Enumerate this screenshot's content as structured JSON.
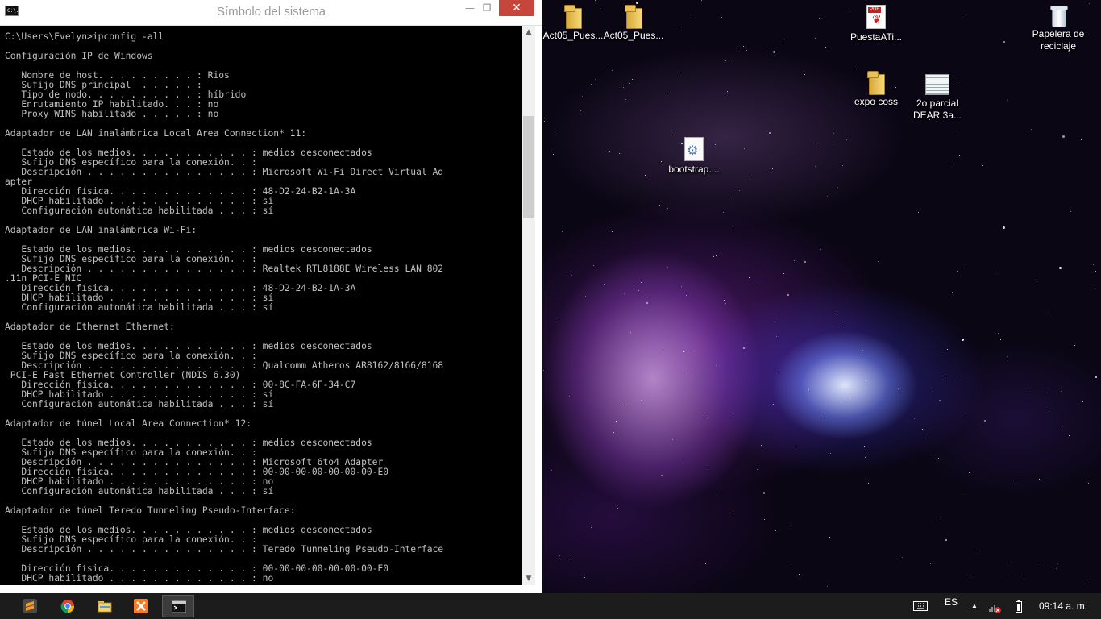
{
  "window": {
    "title": "Símbolo del sistema",
    "icon_label": "C:\\.",
    "minimize_glyph": "—",
    "maximize_glyph": "❐",
    "close_glyph": "✕"
  },
  "console_lines": [
    "C:\\Users\\Evelyn>ipconfig -all",
    "",
    "Configuración IP de Windows",
    "",
    "   Nombre de host. . . . . . . . . : Rios",
    "   Sufijo DNS principal  . . . . . :",
    "   Tipo de nodo. . . . . . . . . . : híbrido",
    "   Enrutamiento IP habilitado. . . : no",
    "   Proxy WINS habilitado . . . . . : no",
    "",
    "Adaptador de LAN inalámbrica Local Area Connection* 11:",
    "",
    "   Estado de los medios. . . . . . . . . . . : medios desconectados",
    "   Sufijo DNS específico para la conexión. . :",
    "   Descripción . . . . . . . . . . . . . . . : Microsoft Wi-Fi Direct Virtual Ad",
    "apter",
    "   Dirección física. . . . . . . . . . . . . : 48-D2-24-B2-1A-3A",
    "   DHCP habilitado . . . . . . . . . . . . . : sí",
    "   Configuración automática habilitada . . . : sí",
    "",
    "Adaptador de LAN inalámbrica Wi-Fi:",
    "",
    "   Estado de los medios. . . . . . . . . . . : medios desconectados",
    "   Sufijo DNS específico para la conexión. . :",
    "   Descripción . . . . . . . . . . . . . . . : Realtek RTL8188E Wireless LAN 802",
    ".11n PCI-E NIC",
    "   Dirección física. . . . . . . . . . . . . : 48-D2-24-B2-1A-3A",
    "   DHCP habilitado . . . . . . . . . . . . . : sí",
    "   Configuración automática habilitada . . . : sí",
    "",
    "Adaptador de Ethernet Ethernet:",
    "",
    "   Estado de los medios. . . . . . . . . . . : medios desconectados",
    "   Sufijo DNS específico para la conexión. . :",
    "   Descripción . . . . . . . . . . . . . . . : Qualcomm Atheros AR8162/8166/8168",
    " PCI-E Fast Ethernet Controller (NDIS 6.30)",
    "   Dirección física. . . . . . . . . . . . . : 00-8C-FA-6F-34-C7",
    "   DHCP habilitado . . . . . . . . . . . . . : sí",
    "   Configuración automática habilitada . . . : sí",
    "",
    "Adaptador de túnel Local Area Connection* 12:",
    "",
    "   Estado de los medios. . . . . . . . . . . : medios desconectados",
    "   Sufijo DNS específico para la conexión. . :",
    "   Descripción . . . . . . . . . . . . . . . : Microsoft 6to4 Adapter",
    "   Dirección física. . . . . . . . . . . . . : 00-00-00-00-00-00-00-E0",
    "   DHCP habilitado . . . . . . . . . . . . . : no",
    "   Configuración automática habilitada . . . : sí",
    "",
    "Adaptador de túnel Teredo Tunneling Pseudo-Interface:",
    "",
    "   Estado de los medios. . . . . . . . . . . : medios desconectados",
    "   Sufijo DNS específico para la conexión. . :",
    "   Descripción . . . . . . . . . . . . . . . : Teredo Tunneling Pseudo-Interface",
    "",
    "   Dirección física. . . . . . . . . . . . . : 00-00-00-00-00-00-00-E0",
    "   DHCP habilitado . . . . . . . . . . . . . : no"
  ],
  "scrollbar": {
    "up_glyph": "▲",
    "down_glyph": "▼"
  },
  "desktop_icons": [
    {
      "name": "folder-act05-1",
      "label": "Act05_Pues...",
      "type": "folder"
    },
    {
      "name": "folder-act05-2",
      "label": "Act05_Pues...",
      "type": "folder"
    },
    {
      "name": "pdf-puesta",
      "label": "PuestaATi...",
      "type": "pdf"
    },
    {
      "name": "recycle-bin",
      "label": "Papelera de reciclaje",
      "type": "bin"
    },
    {
      "name": "folder-expo-coss",
      "label": "expo coss",
      "type": "folder"
    },
    {
      "name": "doc-2o-parcial",
      "label": "2o parcial DEAR 3a...",
      "type": "doc"
    },
    {
      "name": "file-bootstrap",
      "label": "bootstrap....",
      "type": "cfg"
    }
  ],
  "pdf_tag": "PDF",
  "taskbar": {
    "apps": [
      {
        "name": "sublime-text",
        "icon": "sublime-icon"
      },
      {
        "name": "chrome",
        "icon": "chrome-icon"
      },
      {
        "name": "file-explorer",
        "icon": "folder-icon"
      },
      {
        "name": "xampp",
        "icon": "xampp-icon"
      },
      {
        "name": "command-prompt",
        "icon": "cmd-icon"
      }
    ],
    "language": "ES",
    "clock": "09:14 a. m.",
    "tray_arrow": "▲"
  },
  "colors": {
    "close_button": "#c7463b",
    "console_text": "#c0c0c0",
    "console_bg": "#000000",
    "taskbar_bg": "#1c1c1c"
  }
}
